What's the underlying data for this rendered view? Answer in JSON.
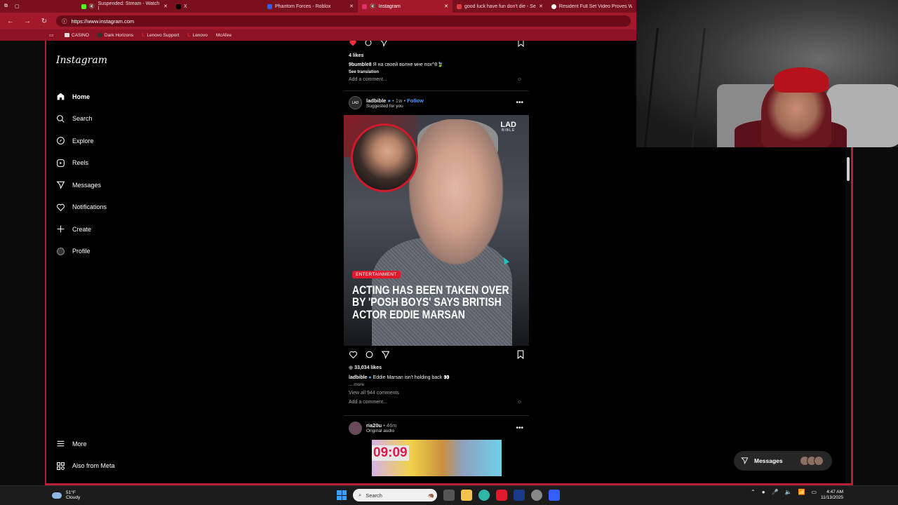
{
  "browser": {
    "tabs": [
      {
        "title": "Suspended: Stream - Watch l",
        "color": "#53fc18"
      },
      {
        "title": "X",
        "color": "#000000"
      },
      {
        "title": "Phantom Forces - Roblox",
        "color": "#335fff"
      },
      {
        "title": "Instagram",
        "color": "#e1306c"
      },
      {
        "title": "good luck have fun don't die - Se",
        "color": "#e23b3b"
      },
      {
        "title": "Resident Full Set Video Proves W",
        "color": "#ffffff"
      }
    ],
    "url": "https://www.instagram.com",
    "bookmarks": [
      "CASINO",
      "Dark Horizons",
      "Lenovo Support",
      "Lenovo",
      "McAfee"
    ]
  },
  "instagram": {
    "logo": "Instagram",
    "nav": [
      {
        "label": "Home",
        "icon": "home-icon"
      },
      {
        "label": "Search",
        "icon": "search-icon"
      },
      {
        "label": "Explore",
        "icon": "compass-icon"
      },
      {
        "label": "Reels",
        "icon": "reels-icon"
      },
      {
        "label": "Messages",
        "icon": "send-icon"
      },
      {
        "label": "Notifications",
        "icon": "heart-icon"
      },
      {
        "label": "Create",
        "icon": "plus-icon"
      },
      {
        "label": "Profile",
        "icon": "avatar-icon"
      }
    ],
    "nav_bottom": [
      {
        "label": "More",
        "icon": "menu-icon"
      },
      {
        "label": "Also from Meta",
        "icon": "meta-grid-icon"
      }
    ],
    "prev_post": {
      "likes": "4 likes",
      "caption_user": "9bumble8",
      "caption_text": "Я на своей волне мне пох^8🍃",
      "see_translation": "See translation",
      "comment_placeholder": "Add a comment..."
    },
    "post": {
      "username": "ladbible",
      "time": "• 1w •",
      "follow": "Follow",
      "subtitle": "Suggested for you",
      "image": {
        "brand": "LAD",
        "brand_sub": "BIBLE",
        "category": "ENTERTAINMENT",
        "headline": "ACTING HAS BEEN TAKEN OVER BY 'POSH BOYS' SAYS BRITISH ACTOR EDDIE MARSAN"
      },
      "likes": "33,034 likes",
      "caption_user": "ladbible",
      "caption_text": "Eddie Marsan isn't holding back 👀",
      "more": "... more",
      "view_comments": "View all 944 comments",
      "comment_placeholder": "Add a comment..."
    },
    "next_post": {
      "username": "ria20u",
      "time": "• 46m",
      "subtitle": "Original audio",
      "thumb_text": "09:09"
    },
    "messages_pill": "Messages"
  },
  "taskbar": {
    "temp": "51°F",
    "condition": "Cloudy",
    "search_placeholder": "Search",
    "time": "4:47 AM",
    "date": "11/13/2025"
  }
}
